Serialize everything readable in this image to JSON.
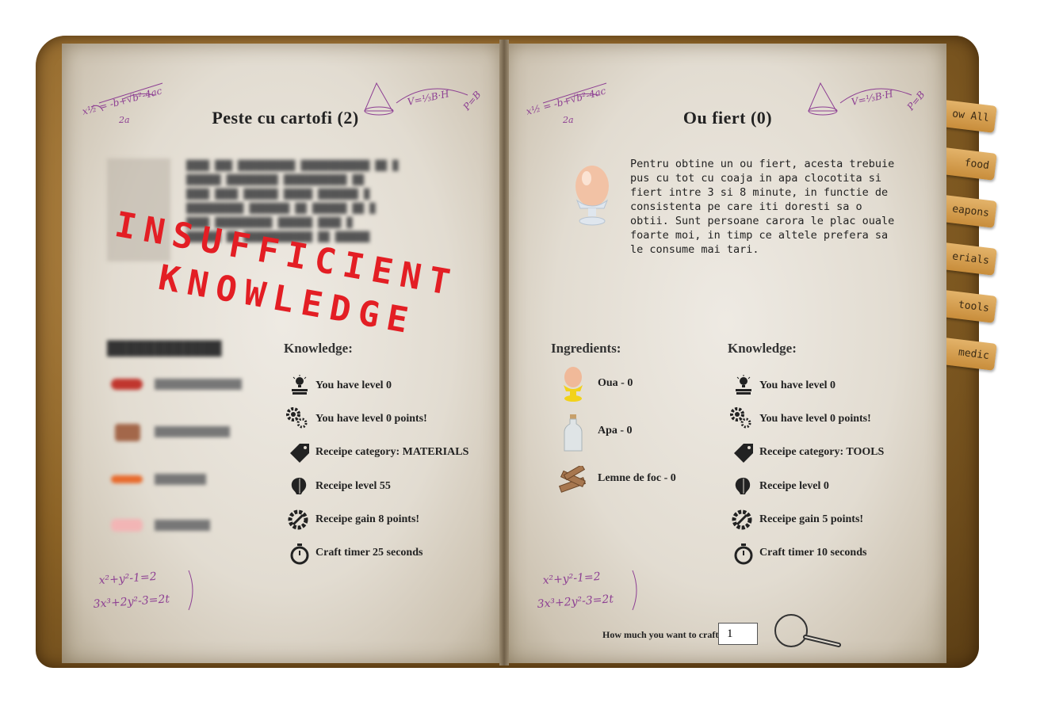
{
  "tabs": [
    {
      "label": "ow All"
    },
    {
      "label": "food"
    },
    {
      "label": "eapons"
    },
    {
      "label": "erials"
    },
    {
      "label": "tools"
    },
    {
      "label": "medic"
    }
  ],
  "left": {
    "title": "Peste cu cartofi (2)",
    "stamp_line1": "INSUFFICIENT",
    "stamp_line2": "KNOWLEDGE",
    "ingredients_header": "Ingredients:",
    "knowledge_header": "Knowledge:",
    "knowledge": [
      {
        "icon": "lightbulb-book-icon",
        "text": "You have level 0"
      },
      {
        "icon": "gears-icon",
        "text": "You have level 0 points!"
      },
      {
        "icon": "tag-icon",
        "text": "Receipe category: MATERIALS"
      },
      {
        "icon": "brain-icon",
        "text": "Receipe level 55"
      },
      {
        "icon": "gear-wrench-icon",
        "text": "Receipe gain 8 points!"
      },
      {
        "icon": "stopwatch-icon",
        "text": "Craft timer 25 seconds"
      }
    ]
  },
  "right": {
    "title": "Ou fiert (0)",
    "description": "Pentru obtine un ou fiert, acesta trebuie pus cu tot cu coaja in apa clocotita si fiert intre 3 si 8 minute, in functie de consistenta pe care iti doresti sa o obtii. Sunt persoane carora le plac ouale foarte moi, in timp ce altele prefera sa le consume mai tari.",
    "ingredients_header": "Ingredients:",
    "knowledge_header": "Knowledge:",
    "ingredients": [
      {
        "icon": "egg-cup-icon",
        "text": "Oua - 0"
      },
      {
        "icon": "water-bottle-icon",
        "text": "Apa - 0"
      },
      {
        "icon": "firewood-icon",
        "text": "Lemne de foc - 0"
      }
    ],
    "knowledge": [
      {
        "icon": "lightbulb-book-icon",
        "text": "You have level 0"
      },
      {
        "icon": "gears-icon",
        "text": "You have level 0 points!"
      },
      {
        "icon": "tag-icon",
        "text": "Receipe category: TOOLS"
      },
      {
        "icon": "brain-icon",
        "text": "Receipe level 0"
      },
      {
        "icon": "gear-wrench-icon",
        "text": "Receipe gain 5 points!"
      },
      {
        "icon": "stopwatch-icon",
        "text": "Craft timer 10 seconds"
      }
    ]
  },
  "craft": {
    "label": "How much you want to craft?",
    "value": "1"
  }
}
